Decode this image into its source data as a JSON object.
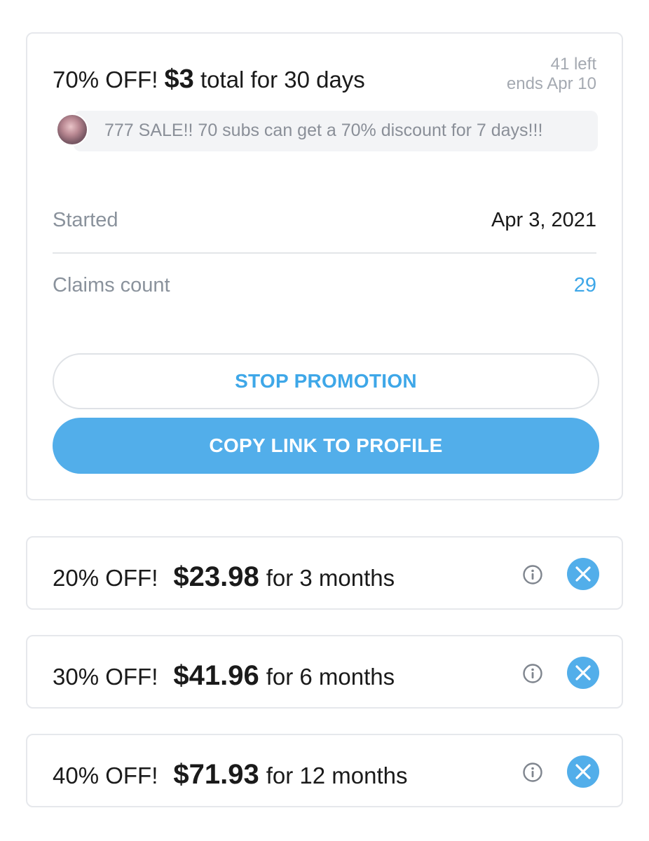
{
  "promotion": {
    "discount": "70% OFF!",
    "price": "$3",
    "duration": "total for 30 days",
    "remaining": "41 left",
    "ends": "ends Apr 10",
    "message": "777 SALE!! 70 subs can get a 70% discount for 7 days!!!",
    "started_label": "Started",
    "started_value": "Apr 3, 2021",
    "claims_label": "Claims count",
    "claims_value": "29",
    "stop_button": "STOP PROMOTION",
    "copy_button": "COPY LINK TO PROFILE"
  },
  "bundles": [
    {
      "discount": "20% OFF!",
      "price": "$23.98",
      "duration": "for 3 months"
    },
    {
      "discount": "30% OFF!",
      "price": "$41.96",
      "duration": "for 6 months"
    },
    {
      "discount": "40% OFF!",
      "price": "$71.93",
      "duration": "for 12 months"
    }
  ],
  "colors": {
    "accent": "#52aeea",
    "accent_text": "#3ea7e8",
    "muted_text": "#8a929c",
    "border": "#e6e8ec"
  },
  "icons": {
    "info": "info-icon",
    "remove": "close-icon"
  }
}
